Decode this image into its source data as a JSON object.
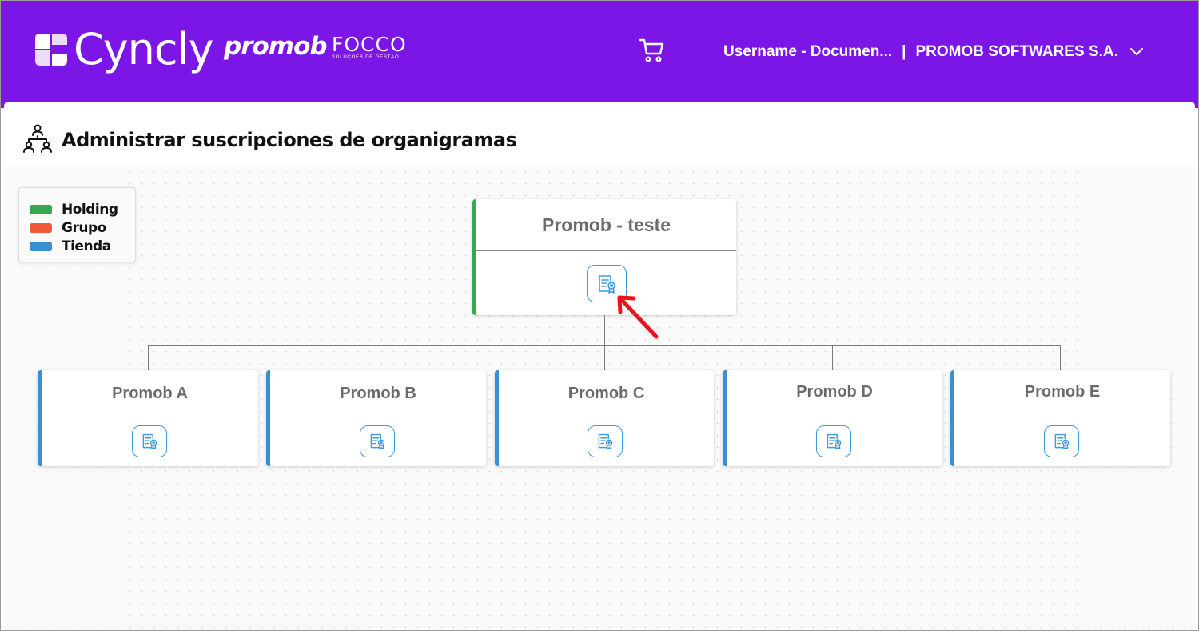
{
  "header": {
    "brand_cyncly": "Cyncly",
    "brand_promob": "promob",
    "brand_focco": "FOCCO",
    "brand_focco_tagline": "SOLUÇÕES DE GESTÃO",
    "cart_icon": "cart-icon",
    "username": "Username - Documen...",
    "separator": "|",
    "company": "PROMOB SOFTWARES S.A.",
    "user_menu_icon": "chevron-down-icon",
    "color": "#7b16e6"
  },
  "page": {
    "title": "Administrar suscripciones de organigramas",
    "title_icon": "org-chart-icon"
  },
  "legend": {
    "items": [
      {
        "label": "Holding",
        "color": "#34a853"
      },
      {
        "label": "Grupo",
        "color": "#f05a3a"
      },
      {
        "label": "Tienda",
        "color": "#3a8fd0"
      }
    ]
  },
  "org_chart": {
    "root": {
      "name": "Promob - teste",
      "type": "Holding",
      "color": "#34a853",
      "action_icon": "certificate-icon"
    },
    "children": [
      {
        "name": "Promob A",
        "type": "Tienda",
        "color": "#3a8fd0",
        "action_icon": "certificate-icon"
      },
      {
        "name": "Promob B",
        "type": "Tienda",
        "color": "#3a8fd0",
        "action_icon": "certificate-icon"
      },
      {
        "name": "Promob C",
        "type": "Tienda",
        "color": "#3a8fd0",
        "action_icon": "certificate-icon"
      },
      {
        "name": "Promob D",
        "type": "Tienda",
        "color": "#3a8fd0",
        "action_icon": "certificate-icon"
      },
      {
        "name": "Promob E",
        "type": "Tienda",
        "color": "#3a8fd0",
        "action_icon": "certificate-icon"
      }
    ]
  },
  "annotation": {
    "icon": "red-arrow-icon",
    "color": "#e8131b"
  }
}
